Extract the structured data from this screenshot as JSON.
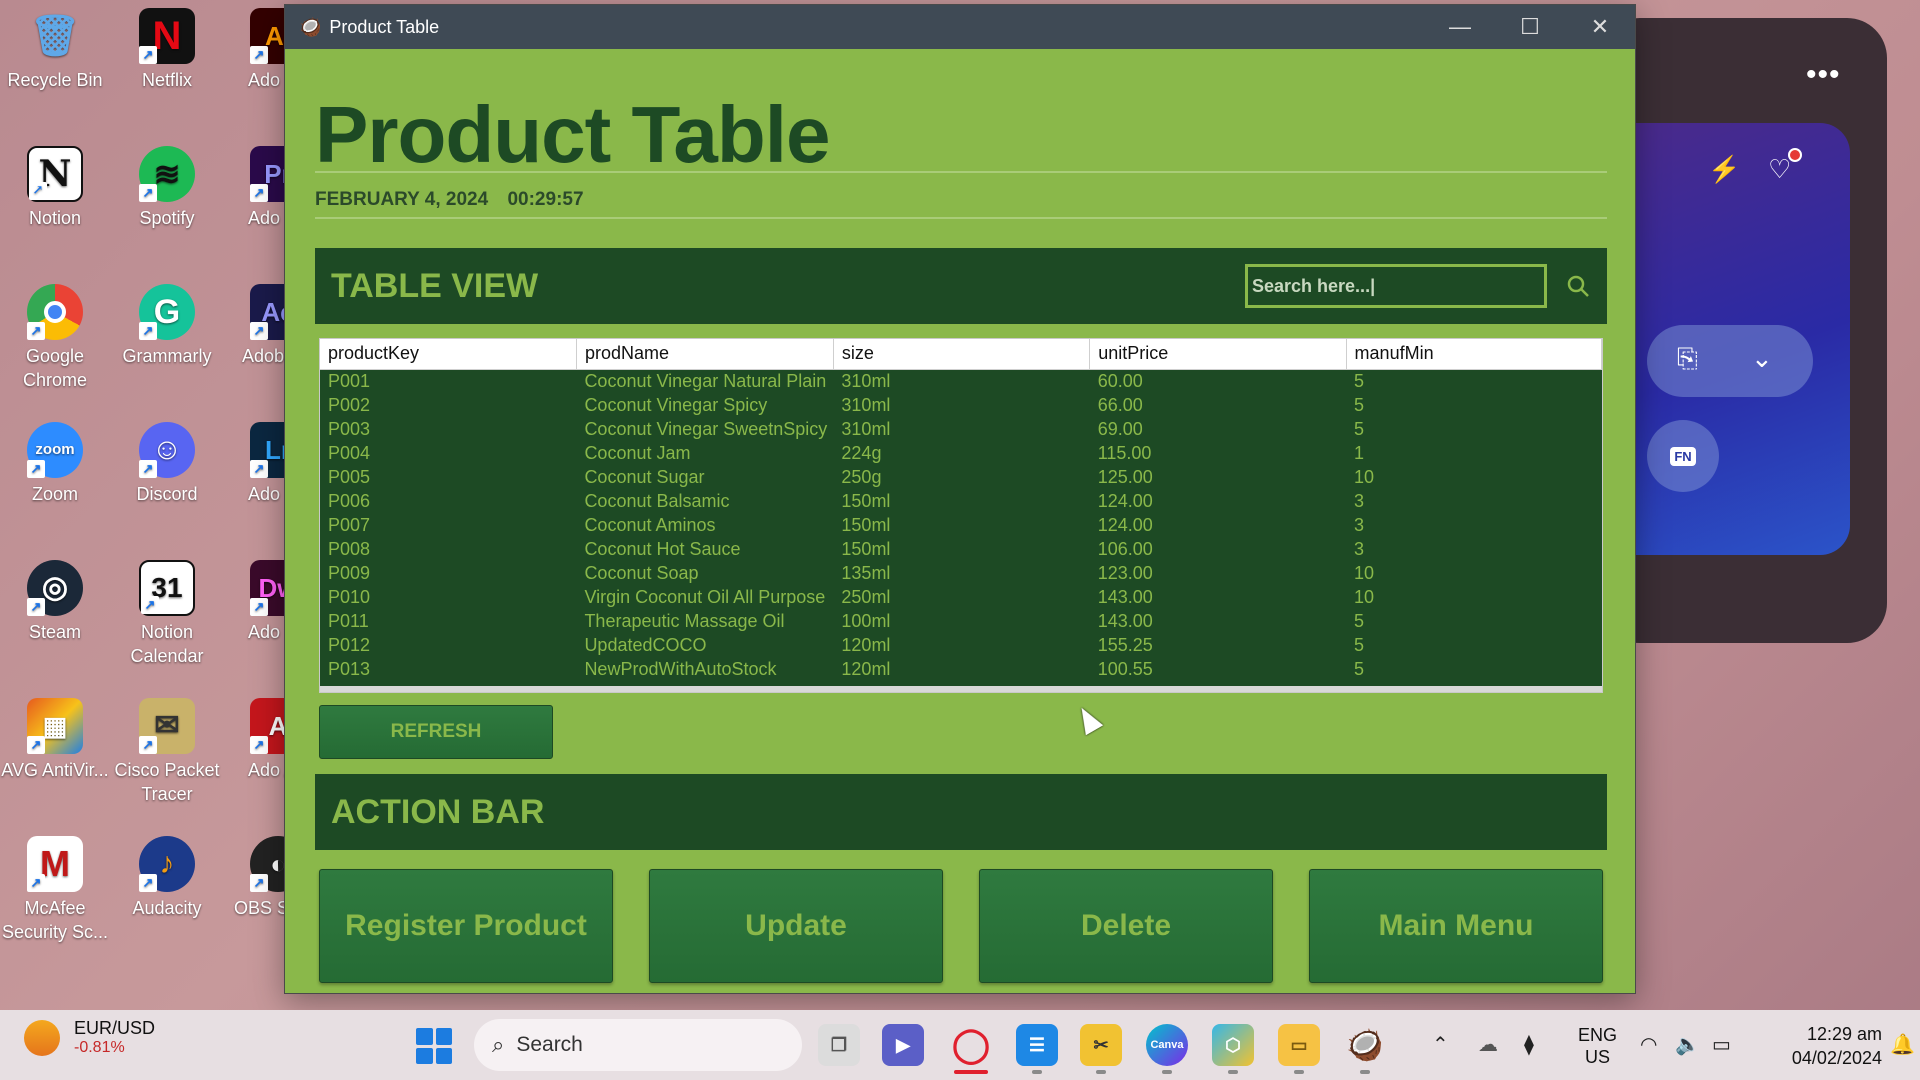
{
  "desktop": {
    "icons": [
      {
        "label": "Recycle Bin",
        "glyph": "🗑",
        "color": "#5fa8e8"
      },
      {
        "label": "Netflix",
        "glyph": "N",
        "color": "#111111"
      },
      {
        "label": "Ado Illust",
        "glyph": "Ai",
        "color": "#330000"
      },
      {
        "label": "Notion",
        "glyph": "N",
        "color": "#ffffff"
      },
      {
        "label": "Spotify",
        "glyph": "♫",
        "color": "#1db954"
      },
      {
        "label": "Ado Premi",
        "glyph": "Pr",
        "color": "#2a0a4a"
      },
      {
        "label": "Google Chrome",
        "glyph": "◉",
        "color": "#e8453c"
      },
      {
        "label": "Grammarly",
        "glyph": "G",
        "color": "#15c39a"
      },
      {
        "label": "Adobe Effects",
        "glyph": "Ae",
        "color": "#1a1a4a"
      },
      {
        "label": "Zoom",
        "glyph": "zoom",
        "color": "#2d8cff"
      },
      {
        "label": "Discord",
        "glyph": "☺",
        "color": "#5865f2"
      },
      {
        "label": "Ado Lightr",
        "glyph": "Lr",
        "color": "#0b2740"
      },
      {
        "label": "Steam",
        "glyph": "◎",
        "color": "#1b2838"
      },
      {
        "label": "Notion Calendar",
        "glyph": "31",
        "color": "#ffffff"
      },
      {
        "label": "Ado Dream",
        "glyph": "Dw",
        "color": "#3a0a2a"
      },
      {
        "label": "AVG AntiVir...",
        "glyph": "▦",
        "color": "#e65a1e"
      },
      {
        "label": "Cisco Packet Tracer",
        "glyph": "✉",
        "color": "#c9b26a"
      },
      {
        "label": "Ado Acrob",
        "glyph": "A",
        "color": "#c4161c"
      },
      {
        "label": "McAfee Security Sc...",
        "glyph": "M",
        "color": "#c01818"
      },
      {
        "label": "Audacity",
        "glyph": "♪",
        "color": "#1c3a8a"
      },
      {
        "label": "OBS S",
        "glyph": "◐",
        "color": "#222222"
      }
    ]
  },
  "window": {
    "title": "Product Table",
    "controls": {
      "minimize": "—",
      "maximize": "☐",
      "close": "✕"
    }
  },
  "header": {
    "title": "Product Table",
    "date": "FEBRUARY 4, 2024",
    "time": "00:29:57"
  },
  "table_view": {
    "heading": "TABLE VIEW",
    "search_value": "Search here...|",
    "columns": [
      "productKey",
      "prodName",
      "size",
      "unitPrice",
      "manufMin"
    ],
    "rows": [
      [
        "P001",
        "Coconut Vinegar Natural Plain",
        "310ml",
        "60.00",
        "5"
      ],
      [
        "P002",
        "Coconut Vinegar Spicy",
        "310ml",
        "66.00",
        "5"
      ],
      [
        "P003",
        "Coconut Vinegar SweetnSpicy",
        "310ml",
        "69.00",
        "5"
      ],
      [
        "P004",
        "Coconut Jam",
        "224g",
        "115.00",
        "1"
      ],
      [
        "P005",
        "Coconut Sugar",
        "250g",
        "125.00",
        "10"
      ],
      [
        "P006",
        "Coconut Balsamic",
        "150ml",
        "124.00",
        "3"
      ],
      [
        "P007",
        "Coconut Aminos",
        "150ml",
        "124.00",
        "3"
      ],
      [
        "P008",
        "Coconut Hot Sauce",
        "150ml",
        "106.00",
        "3"
      ],
      [
        "P009",
        "Coconut Soap",
        "135ml",
        "123.00",
        "10"
      ],
      [
        "P010",
        "Virgin Coconut Oil All Purpose",
        "250ml",
        "143.00",
        "10"
      ],
      [
        "P011",
        "Therapeutic Massage Oil",
        "100ml",
        "143.00",
        "5"
      ],
      [
        "P012",
        "UpdatedCOCO",
        "120ml",
        "155.25",
        "5"
      ],
      [
        "P013",
        "NewProdWithAutoStock",
        "120ml",
        "100.55",
        "5"
      ]
    ],
    "refresh_label": "REFRESH"
  },
  "action_bar": {
    "heading": "ACTION BAR",
    "buttons": [
      "Register Product",
      "Update",
      "Delete",
      "Main Menu"
    ]
  },
  "taskbar": {
    "widget_title": "EUR/USD",
    "widget_value": "-0.81%",
    "search_label": "Search",
    "lang_top": "ENG",
    "lang_bottom": "US",
    "clock_time": "12:29 am",
    "clock_date": "04/02/2024"
  },
  "phone_widget": {
    "menu": "•••",
    "fn_label": "FN"
  },
  "colors": {
    "app_bg": "#8ab84a",
    "dark_green": "#1d4a24",
    "titlebar": "#3f4a55"
  }
}
